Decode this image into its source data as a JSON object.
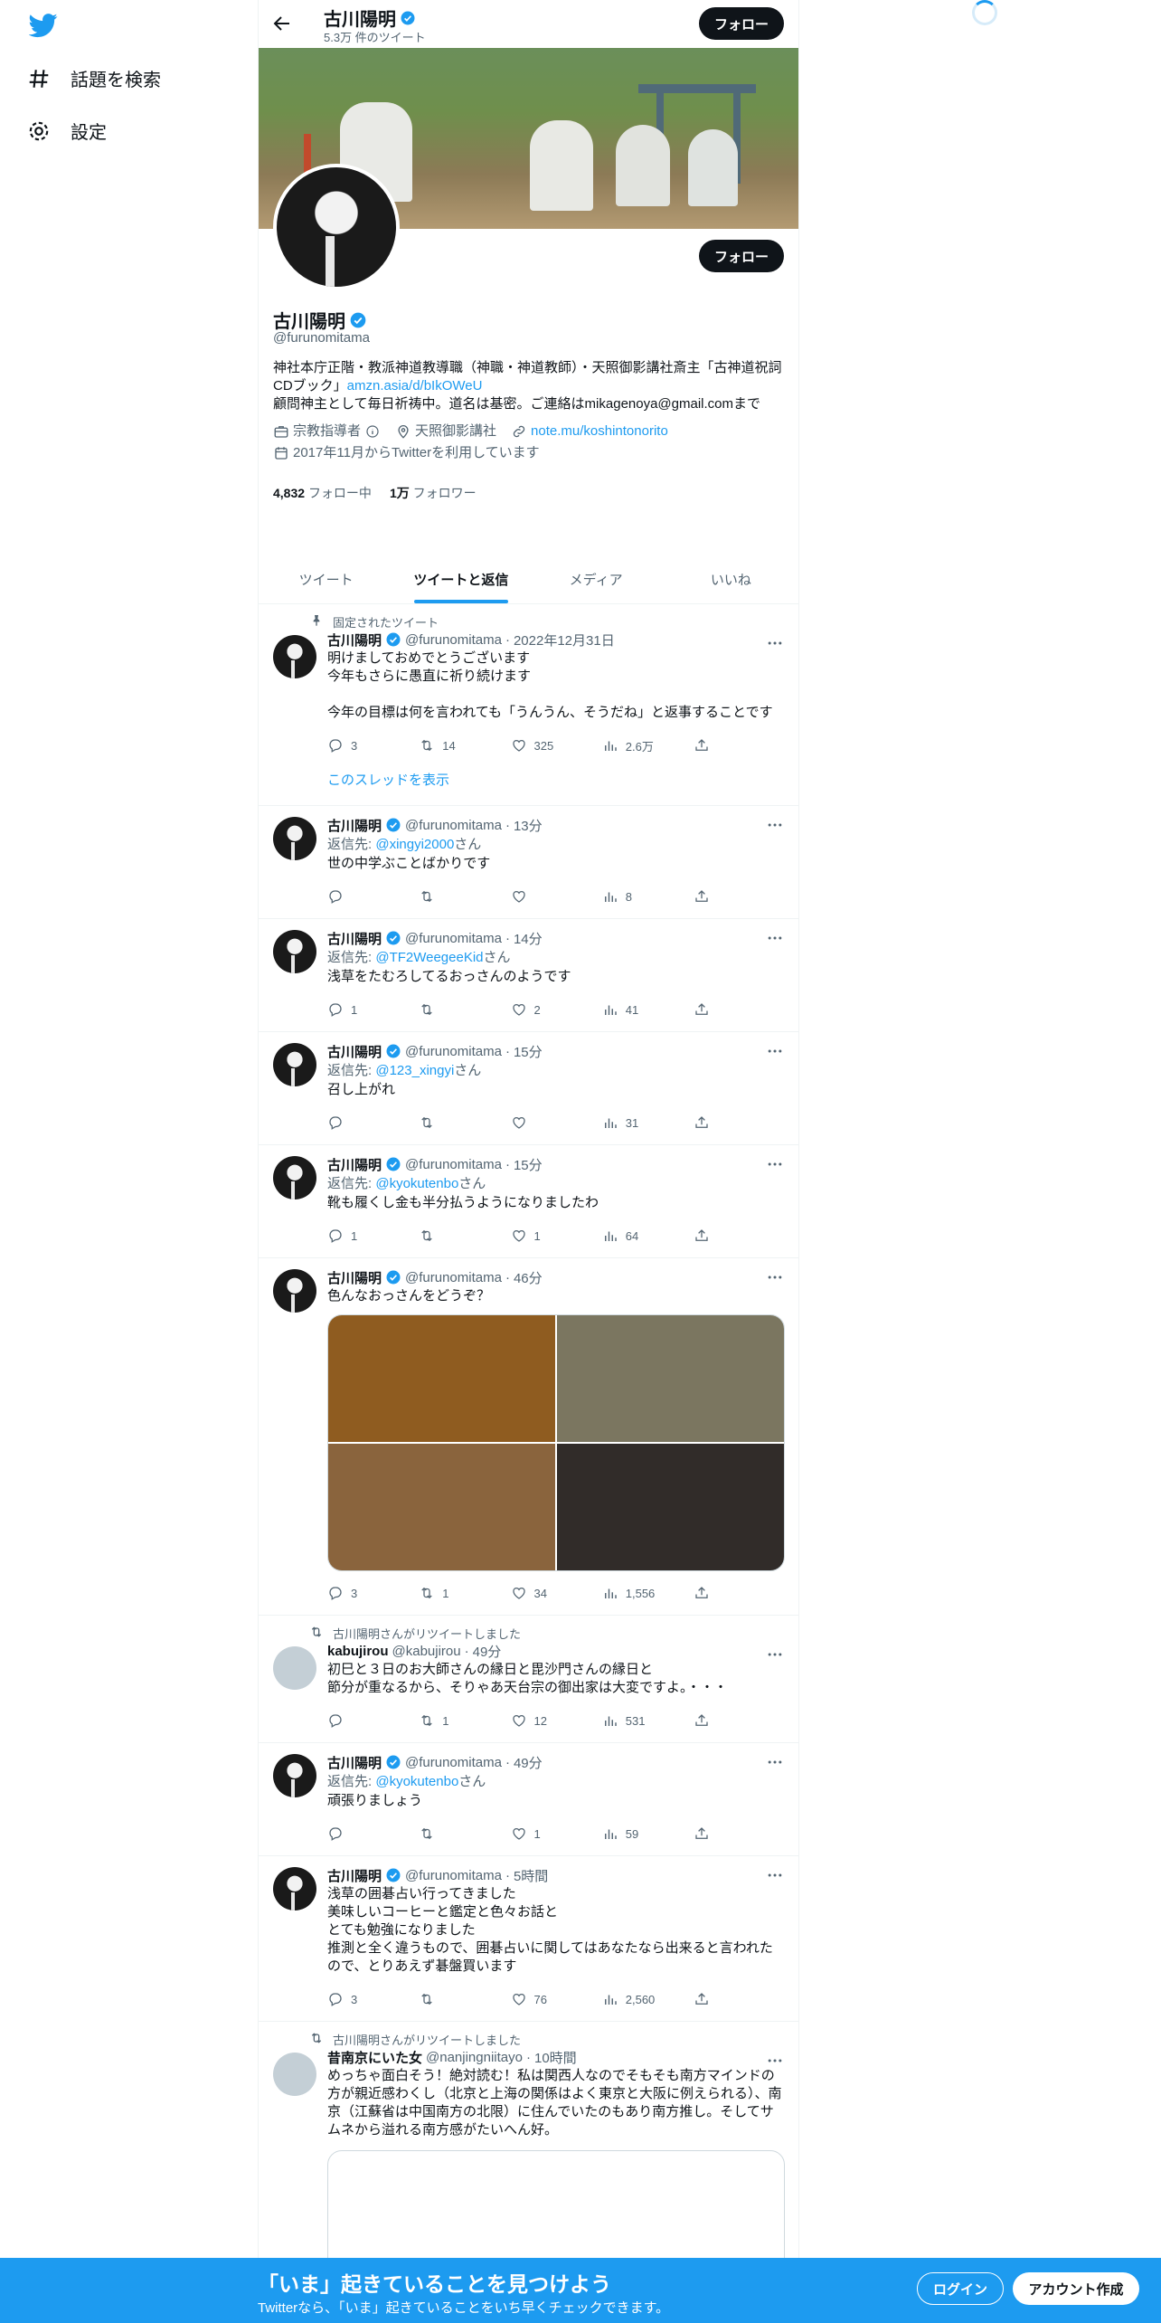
{
  "nav": {
    "explore_label": "話題を検索",
    "settings_label": "設定"
  },
  "header": {
    "name": "古川陽明",
    "tweet_count": "5.3万 件のツイート",
    "follow_label": "フォロー"
  },
  "profile": {
    "name": "古川陽明",
    "handle": "@furunomitama",
    "follow_label": "フォロー",
    "bio_line1": "神社本庁正階・教派神道教導職（神職・神道教師）・天照御影講社斎主「古神道祝詞CDブック」",
    "bio_link": "amzn.asia/d/bIkOWeU",
    "bio_line2": "顧問神主として毎日祈祷中。道名は基密。ご連絡はmikagenoya@gmail.comまで",
    "category": "宗教指導者",
    "location": "天照御影講社",
    "website": "note.mu/koshintonorito",
    "joined": "2017年11月からTwitterを利用しています",
    "following_count": "4,832",
    "following_label": "フォロー中",
    "followers_count": "1万",
    "followers_label": "フォロワー"
  },
  "tabs": [
    "ツイート",
    "ツイートと返信",
    "メディア",
    "いいね"
  ],
  "pinned_label": "固定されたツイート",
  "show_thread_label": "このスレッドを表示",
  "reply_to_label": "返信先: ",
  "reply_suffix": "さん",
  "tweets": [
    {
      "name": "古川陽明",
      "handle": "@furunomitama",
      "time": "2022年12月31日",
      "text": "明けましておめでとうございます\n今年もさらに愚直に祈り続けます\n\n今年の目標は何を言われても「うんうん、そうだね」と返事することです",
      "replies": "3",
      "retweets": "14",
      "likes": "325",
      "views": "2.6万"
    },
    {
      "name": "古川陽明",
      "handle": "@furunomitama",
      "time": "13分",
      "reply_to": "@xingyi2000",
      "text": "世の中学ぶことばかりです",
      "replies": "",
      "retweets": "",
      "likes": "",
      "views": "8"
    },
    {
      "name": "古川陽明",
      "handle": "@furunomitama",
      "time": "14分",
      "reply_to": "@TF2WeegeeKid",
      "text": "浅草をたむろしてるおっさんのようです",
      "replies": "1",
      "retweets": "",
      "likes": "2",
      "views": "41"
    },
    {
      "name": "古川陽明",
      "handle": "@furunomitama",
      "time": "15分",
      "reply_to": "@123_xingyi",
      "text": "召し上がれ",
      "replies": "",
      "retweets": "",
      "likes": "",
      "views": "31"
    },
    {
      "name": "古川陽明",
      "handle": "@furunomitama",
      "time": "15分",
      "reply_to": "@kyokutenbo",
      "text": "靴も履くし金も半分払うようになりましたわ",
      "replies": "1",
      "retweets": "",
      "likes": "1",
      "views": "64"
    },
    {
      "name": "古川陽明",
      "handle": "@furunomitama",
      "time": "46分",
      "text": "色んなおっさんをどうぞ？",
      "image_colors": [
        "#8f5c20",
        "#7b7660",
        "#8a643d",
        "#312c29"
      ],
      "replies": "3",
      "retweets": "1",
      "likes": "34",
      "views": "1,556"
    },
    {
      "retweeted_by": "古川陽明さんがリツイートしました",
      "name": "kabujirou",
      "handle": "@kabujirou",
      "time": "49分",
      "text": "初巳と３日のお大師さんの縁日と毘沙門さんの縁日と\n節分が重なるから、そりゃあ天台宗の御出家は大変ですよ。・・・",
      "replies": "",
      "retweets": "1",
      "likes": "12",
      "views": "531"
    },
    {
      "name": "古川陽明",
      "handle": "@furunomitama",
      "time": "49分",
      "reply_to": "@kyokutenbo",
      "text": "頑張りましょう",
      "replies": "",
      "retweets": "",
      "likes": "1",
      "views": "59"
    },
    {
      "name": "古川陽明",
      "handle": "@furunomitama",
      "time": "5時間",
      "text": "浅草の囲碁占い行ってきました\n美味しいコーヒーと鑑定と色々お話と\nとても勉強になりました\n推測と全く違うもので、囲碁占いに関してはあなたなら出来ると言われたので、とりあえず碁盤買います",
      "replies": "3",
      "retweets": "",
      "likes": "76",
      "views": "2,560"
    },
    {
      "retweeted_by": "古川陽明さんがリツイートしました",
      "name": "昔南京にいた女",
      "handle": "@nanjingniitayo",
      "time": "10時間",
      "text": "めっちゃ面白そう！絶対読む！私は関西人なのでそもそも南方マインドの方が親近感わくし（北京と上海の関係はよく東京と大阪に例えられる）、南京（江蘇省は中国南方の北限）に住んでいたのもあり南方推し。そしてサムネから溢れる南方感がたいへん好。"
    }
  ],
  "bottom": {
    "title": "「いま」起きていることを見つけよう",
    "subtitle": "Twitterなら、「いま」起きていることをいち早くチェックできます。",
    "login": "ログイン",
    "signup": "アカウント作成"
  },
  "colors": {
    "accent": "#1d9bf0",
    "text": "#0f1419",
    "muted": "#536471"
  }
}
